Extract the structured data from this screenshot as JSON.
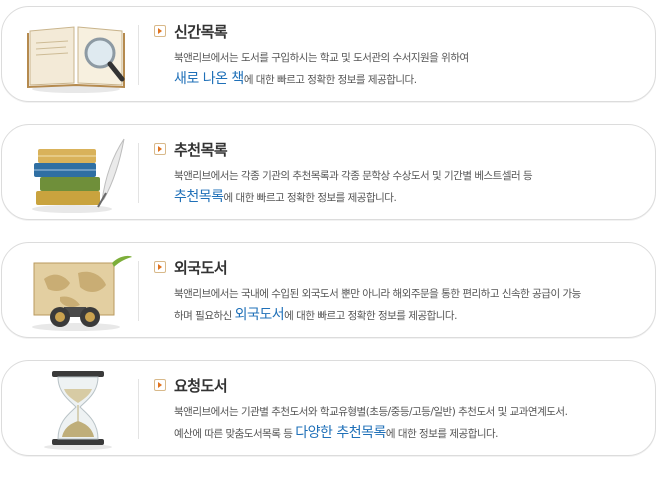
{
  "sections": [
    {
      "title": "신간목록",
      "line1": "북앤리브에서는 도서를 구입하시는 학교 및 도서관의 수서지원을 위하여",
      "line2_pre": "",
      "line2_hl": "새로 나온 책",
      "line2_post": "에 대한 빠르고 정확한 정보를 제공합니다.",
      "icon": "open-book-magnifier-icon"
    },
    {
      "title": "추천목록",
      "line1": "북앤리브에서는 각종 기관의 추천목록과 각종 문학상 수상도서 및 기간별 베스트셀러 등",
      "line2_pre": "",
      "line2_hl": "추천목록",
      "line2_post": "에 대한 빠르고 정확한 정보를 제공합니다.",
      "icon": "book-stack-quill-icon"
    },
    {
      "title": "외국도서",
      "line1": "북앤리브에서는 국내에 수입된 외국도서 뿐만 아니라 해외주문을 통한 편리하고 신속한 공급이  가능",
      "line2_pre": "하며 필요하신 ",
      "line2_hl": "외국도서",
      "line2_post": "에 대한 빠르고 정확한 정보를 제공합니다.",
      "icon": "map-binoculars-icon"
    },
    {
      "title": "요청도서",
      "line1": "북앤리브에서는 기관별 추천도서와 학교유형별(초등/중등/고등/일반) 추천도서 및 교과연계도서.",
      "line2_pre": "예산에 따른 맞춤도서목록 등 ",
      "line2_hl": "다양한 추천목록",
      "line2_post": "에 대한 정보를 제공합니다.",
      "icon": "hourglass-icon"
    }
  ]
}
